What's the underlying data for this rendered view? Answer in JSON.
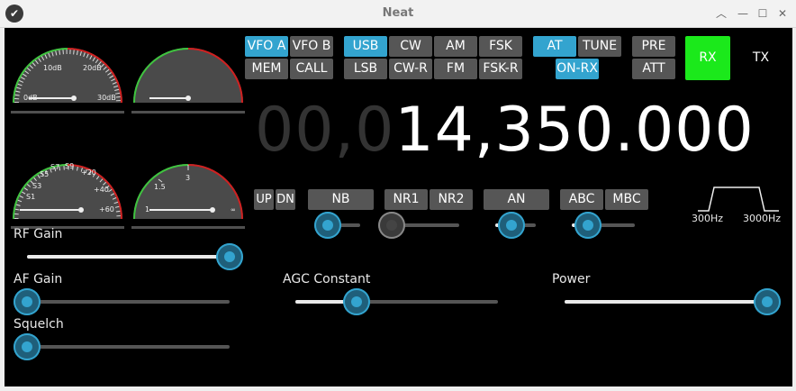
{
  "window": {
    "title": "Neat"
  },
  "gauges": {
    "smeter_db": {
      "ticks": [
        "10dB",
        "20dB",
        "0dB",
        "30dB"
      ]
    },
    "smeter": {
      "ticks": [
        "S7",
        "S9",
        "+20",
        "S5",
        "S3",
        "+40",
        "S1",
        "+60"
      ]
    },
    "swr": {
      "ticks": [
        "3",
        "1.5",
        "1",
        "∞"
      ]
    }
  },
  "buttons": {
    "vfo_a": "VFO A",
    "vfo_b": "VFO B",
    "mem": "MEM",
    "call": "CALL",
    "usb": "USB",
    "cw": "CW",
    "am": "AM",
    "fsk": "FSK",
    "lsb": "LSB",
    "cw_r": "CW-R",
    "fm": "FM",
    "fsk_r": "FSK-R",
    "at": "AT",
    "tune": "TUNE",
    "on_rx": "ON-RX",
    "pre": "PRE",
    "att": "ATT",
    "rx": "RX",
    "tx": "TX",
    "up": "UP",
    "dn": "DN",
    "nb": "NB",
    "nr1": "NR1",
    "nr2": "NR2",
    "an": "AN",
    "abc": "ABC",
    "mbc": "MBC"
  },
  "frequency": {
    "dim": "00,0",
    "bright": "14,350.000"
  },
  "bandwidth": {
    "low": "300Hz",
    "high": "3000Hz"
  },
  "sliders": {
    "rf_gain": {
      "label": "RF Gain",
      "value": 1.0
    },
    "af_gain": {
      "label": "AF Gain",
      "value": 0.0
    },
    "squelch": {
      "label": "Squelch",
      "value": 0.0
    },
    "agc": {
      "label": "AGC Constant",
      "value": 0.3
    },
    "power": {
      "label": "Power",
      "value": 1.0
    },
    "nb_level": {
      "value": 0.2
    },
    "nr_level": {
      "value": 0.0
    },
    "an_level": {
      "value": 0.4
    },
    "abc_level": {
      "value": 0.25
    }
  },
  "colors": {
    "accent": "#33a4cf",
    "rx_active": "#1be91b",
    "gauge_green": "#3fc43f",
    "gauge_red": "#d02020"
  }
}
